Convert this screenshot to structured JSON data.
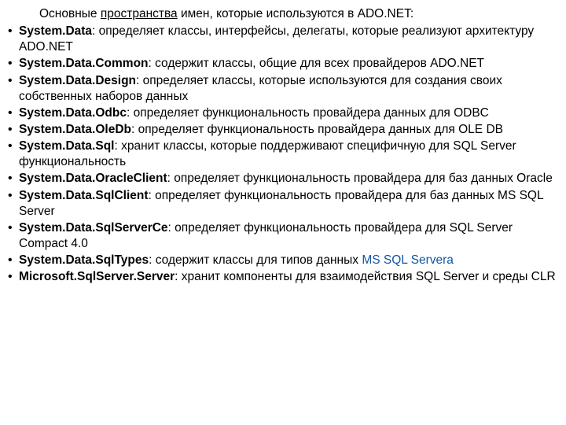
{
  "intro": {
    "pre": "Основные ",
    "underlined": "пространства",
    "post": " имен, которые используются в ADO.NET:"
  },
  "items": [
    {
      "ns": "System.Data",
      "desc": ": определяет классы, интерфейсы, делегаты, которые реализуют архитектуру ADO.NET"
    },
    {
      "ns": "System.Data.Common",
      "desc": ": содержит классы, общие для всех провайдеров ADO.NET"
    },
    {
      "ns": "System.Data.Design",
      "desc": ": определяет классы, которые используются для создания своих собственных наборов данных"
    },
    {
      "ns": "System.Data.Odbc",
      "desc": ": определяет функциональность провайдера данных для ODBC"
    },
    {
      "ns": "System.Data.OleDb",
      "desc": ": определяет функциональность провайдера данных для OLE DB"
    },
    {
      "ns": "System.Data.Sql",
      "desc": ": хранит классы, которые поддерживают специфичную для SQL Server функциональность"
    },
    {
      "ns": "System.Data.OracleClient",
      "desc": ": определяет функциональность провайдера для баз данных Oracle"
    },
    {
      "ns": "System.Data.SqlClient",
      "desc": ": определяет функциональность провайдера для баз данных MS SQL Server"
    },
    {
      "ns": "System.Data.SqlServerCe",
      "desc": ": определяет функциональность провайдера для SQL Server Compact 4.0"
    },
    {
      "ns": "System.Data.SqlTypes",
      "desc": ": содержит классы для типов данных ",
      "link": "MS SQL Servera"
    },
    {
      "ns": "Microsoft.SqlServer.Server",
      "desc": ": хранит компоненты для взаимодействия SQL Server и среды CLR"
    }
  ]
}
